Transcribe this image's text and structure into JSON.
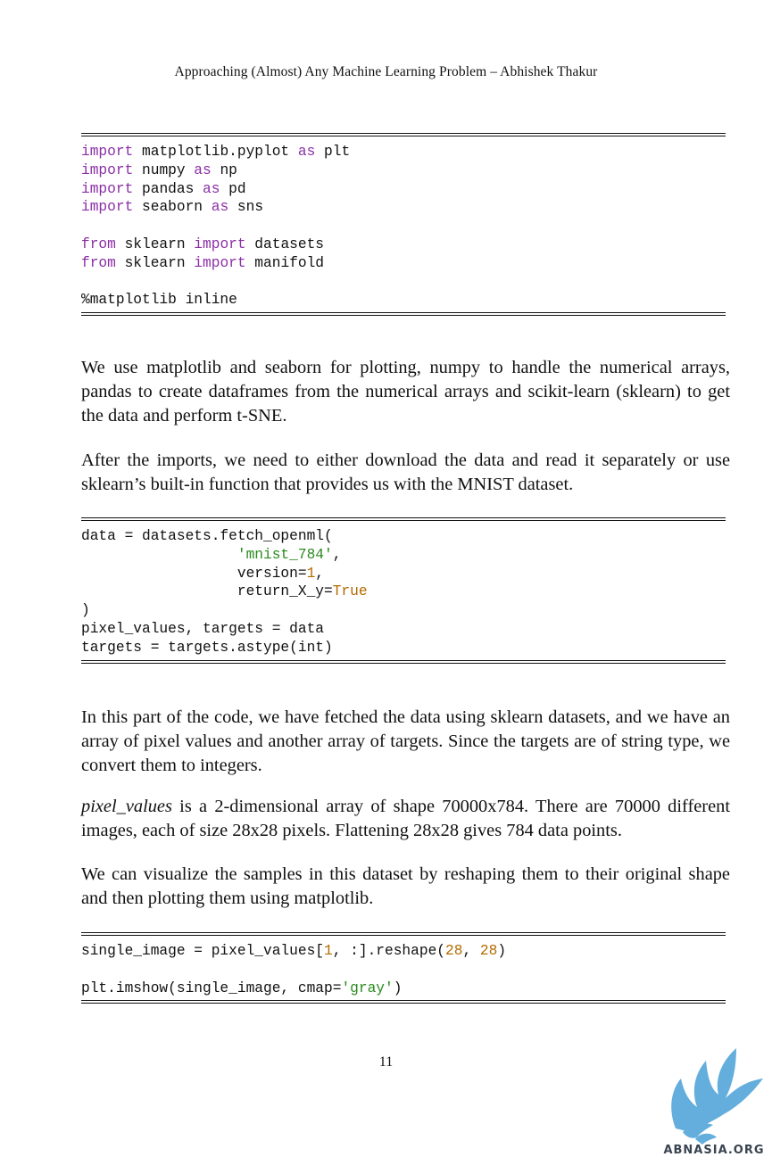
{
  "header": "Approaching (Almost) Any Machine Learning Problem – Abhishek Thakur",
  "code_blocks": [
    {
      "lines": [
        [
          {
            "t": "import",
            "c": "kw"
          },
          {
            "t": " matplotlib.pyplot "
          },
          {
            "t": "as",
            "c": "kw"
          },
          {
            "t": " plt"
          }
        ],
        [
          {
            "t": "import",
            "c": "kw"
          },
          {
            "t": " numpy "
          },
          {
            "t": "as",
            "c": "kw"
          },
          {
            "t": " np"
          }
        ],
        [
          {
            "t": "import",
            "c": "kw"
          },
          {
            "t": " pandas "
          },
          {
            "t": "as",
            "c": "kw"
          },
          {
            "t": " pd"
          }
        ],
        [
          {
            "t": "import",
            "c": "kw"
          },
          {
            "t": " seaborn "
          },
          {
            "t": "as",
            "c": "kw"
          },
          {
            "t": " sns"
          }
        ],
        [],
        [
          {
            "t": "from",
            "c": "kw"
          },
          {
            "t": " sklearn "
          },
          {
            "t": "import",
            "c": "kw"
          },
          {
            "t": " datasets"
          }
        ],
        [
          {
            "t": "from",
            "c": "kw"
          },
          {
            "t": " sklearn "
          },
          {
            "t": "import",
            "c": "kw"
          },
          {
            "t": " manifold"
          }
        ],
        [],
        [
          {
            "t": "%matplotlib inline"
          }
        ]
      ]
    },
    {
      "lines": [
        [
          {
            "t": "data = datasets.fetch_openml("
          }
        ],
        [
          {
            "t": "                  "
          },
          {
            "t": "'mnist_784'",
            "c": "str"
          },
          {
            "t": ","
          }
        ],
        [
          {
            "t": "                  version="
          },
          {
            "t": "1",
            "c": "num"
          },
          {
            "t": ","
          }
        ],
        [
          {
            "t": "                  return_X_y="
          },
          {
            "t": "True",
            "c": "num"
          }
        ],
        [
          {
            "t": ")"
          }
        ],
        [
          {
            "t": "pixel_values, targets = data"
          }
        ],
        [
          {
            "t": "targets = targets.astype(int)"
          }
        ]
      ]
    },
    {
      "lines": [
        [
          {
            "t": "single_image = pixel_values["
          },
          {
            "t": "1",
            "c": "num"
          },
          {
            "t": ", :].reshape("
          },
          {
            "t": "28",
            "c": "num"
          },
          {
            "t": ", "
          },
          {
            "t": "28",
            "c": "num"
          },
          {
            "t": ")"
          }
        ],
        [],
        [
          {
            "t": "plt.imshow(single_image, cmap="
          },
          {
            "t": "'gray'",
            "c": "str"
          },
          {
            "t": ")"
          }
        ]
      ]
    }
  ],
  "paragraphs": {
    "p1": "We use matplotlib and seaborn for plotting, numpy to handle the numerical arrays, pandas to create dataframes from the numerical arrays and scikit-learn (sklearn) to get the data and perform t-SNE.",
    "p2": "After the imports, we need to either download the data and read it separately or use sklearn’s built-in function that provides us with the MNIST dataset.",
    "p3": "In this part of the code, we have fetched the data using sklearn datasets, and we have an array of pixel values and another array of targets. Since the targets are of string type, we convert them to integers.",
    "p4_em": "pixel_values",
    "p4_rest": " is a 2-dimensional array of shape 70000x784. There are 70000 different images, each of size 28x28 pixels. Flattening 28x28 gives 784 data points.",
    "p5": "We can visualize the samples in this dataset by reshaping them to their original shape and then plotting them using matplotlib."
  },
  "page_number": "11",
  "watermark": "ABNASIA.ORG",
  "colors": {
    "keyword": "#8b2fa6",
    "string": "#2a8a1e",
    "number": "#b36b00",
    "logo_blue": "#4fa3d9"
  }
}
